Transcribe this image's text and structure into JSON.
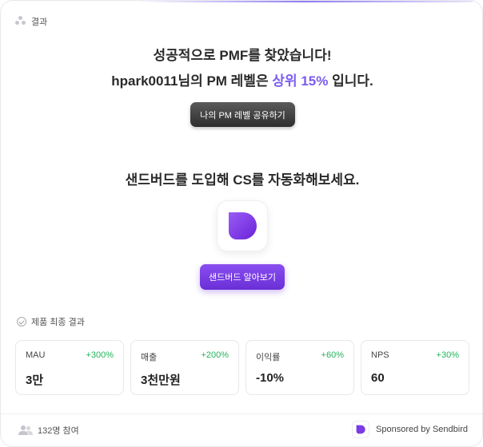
{
  "header": {
    "label": "결과"
  },
  "result": {
    "headline": "성공적으로 PMF를 찾았습니다!",
    "level_prefix": "hpark0011님의 PM 레벨은 ",
    "level_rank": "상위 15%",
    "level_suffix": " 입니다.",
    "share_button": "나의 PM 레벨 공유하기"
  },
  "promo": {
    "headline": "샌드버드를 도입해 CS를 자동화해보세요.",
    "logo_icon": "sendbird-logo-icon",
    "learn_button": "샌드버드 알아보기"
  },
  "metrics_section": {
    "title": "제품 최종 결과",
    "items": [
      {
        "label": "MAU",
        "change": "+300%",
        "value": "3만"
      },
      {
        "label": "매출",
        "change": "+200%",
        "value": "3천만원"
      },
      {
        "label": "이익률",
        "change": "+60%",
        "value": "-10%"
      },
      {
        "label": "NPS",
        "change": "+30%",
        "value": "60"
      }
    ]
  },
  "footer": {
    "participants": "132명 참여",
    "sponsor": "Sponsored by Sendbird"
  },
  "colors": {
    "accent_purple": "#7b5cf0",
    "positive_green": "#22b45a",
    "button_dark": "#2e2e2e"
  }
}
